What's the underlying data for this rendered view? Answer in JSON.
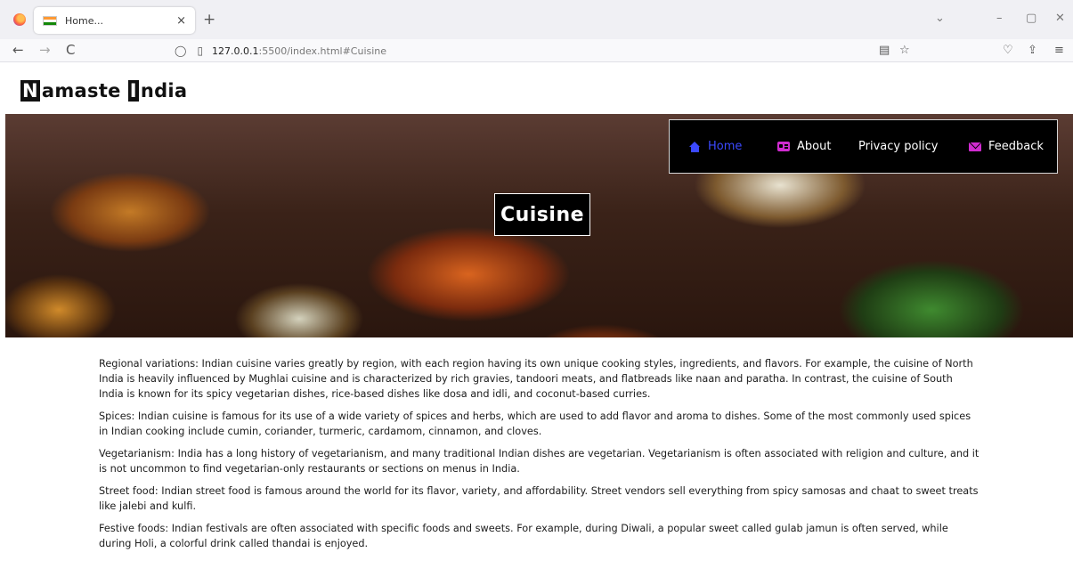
{
  "browser": {
    "tab_title": "Home...",
    "tab_close": "×",
    "new_tab": "+",
    "url_host": "127.0.0.1",
    "url_rest": ":5500/index.html#Cuisine",
    "nav_back": "←",
    "nav_forward": "→",
    "nav_reload": "C",
    "list_all_tabs": "⌄",
    "minimize": "–",
    "restore": "▢",
    "close": "✕",
    "reader": "▤",
    "bookmark": "☆",
    "pocket": "♡",
    "extensions": "⇪",
    "menu": "≡",
    "shield": "◯",
    "page_icon": "▯"
  },
  "site": {
    "logo_letter_1": "N",
    "logo_rest_1": "amaste",
    "logo_letter_2": "I",
    "logo_rest_2": "ndia"
  },
  "menu": {
    "items": [
      {
        "label": "Home",
        "icon": "home-icon",
        "active": true
      },
      {
        "label": "About",
        "icon": "id-card-icon",
        "active": false
      },
      {
        "label": "Privacy policy",
        "icon": "",
        "active": false
      },
      {
        "label": "Feedback",
        "icon": "envelope-icon",
        "active": false
      }
    ]
  },
  "hero": {
    "title": "Cuisine"
  },
  "content": {
    "paragraphs": [
      "Regional variations: Indian cuisine varies greatly by region, with each region having its own unique cooking styles, ingredients, and flavors. For example, the cuisine of North India is heavily influenced by Mughlai cuisine and is characterized by rich gravies, tandoori meats, and flatbreads like naan and paratha. In contrast, the cuisine of South India is known for its spicy vegetarian dishes, rice-based dishes like dosa and idli, and coconut-based curries.",
      "Spices: Indian cuisine is famous for its use of a wide variety of spices and herbs, which are used to add flavor and aroma to dishes. Some of the most commonly used spices in Indian cooking include cumin, coriander, turmeric, cardamom, cinnamon, and cloves.",
      "Vegetarianism: India has a long history of vegetarianism, and many traditional Indian dishes are vegetarian. Vegetarianism is often associated with religion and culture, and it is not uncommon to find vegetarian-only restaurants or sections on menus in India.",
      "Street food: Indian street food is famous around the world for its flavor, variety, and affordability. Street vendors sell everything from spicy samosas and chaat to sweet treats like jalebi and kulfi.",
      "Festive foods: Indian festivals are often associated with specific foods and sweets. For example, during Diwali, a popular sweet called gulab jamun is often served, while during Holi, a colorful drink called thandai is enjoyed."
    ]
  },
  "colors": {
    "active_link": "#3b49ff",
    "icon_accent": "#d02bd0",
    "menu_bg": "#000000"
  }
}
